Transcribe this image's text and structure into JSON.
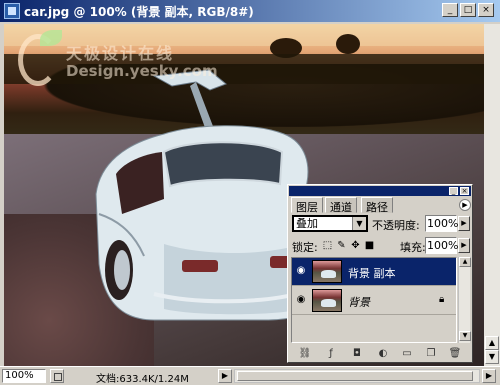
{
  "window": {
    "title": "car.jpg @ 100% (背景 副本, RGB/8#)",
    "controls": [
      "_",
      "□",
      "×"
    ]
  },
  "watermark": {
    "cn": "天极设计在线",
    "en": "Design.yesky.com"
  },
  "status": {
    "zoom": "100%",
    "doc_info": "文档:633.4K/1.24M"
  },
  "layers_panel": {
    "tabs": [
      {
        "label": "图层",
        "active": true
      },
      {
        "label": "通道",
        "active": false
      },
      {
        "label": "路径",
        "active": false
      }
    ],
    "blend_mode": "叠加",
    "opacity_label": "不透明度:",
    "opacity_value": "100%",
    "lock_label": "锁定:",
    "fill_label": "填充:",
    "fill_value": "100%",
    "layers": [
      {
        "name": "背景 副本",
        "selected": true,
        "visible": true,
        "locked": false,
        "italic": false
      },
      {
        "name": "背景",
        "selected": false,
        "visible": true,
        "locked": true,
        "italic": true
      }
    ],
    "bottom_tools": [
      "link-icon",
      "layer-style-icon",
      "layer-mask-icon",
      "adjustment-layer-icon",
      "new-group-icon",
      "new-layer-icon",
      "trash-icon"
    ]
  },
  "colors": {
    "titlebar_start": "#0a246a",
    "titlebar_end": "#a6caf0",
    "selection": "#0a246a",
    "chrome": "#d4d0c8"
  }
}
